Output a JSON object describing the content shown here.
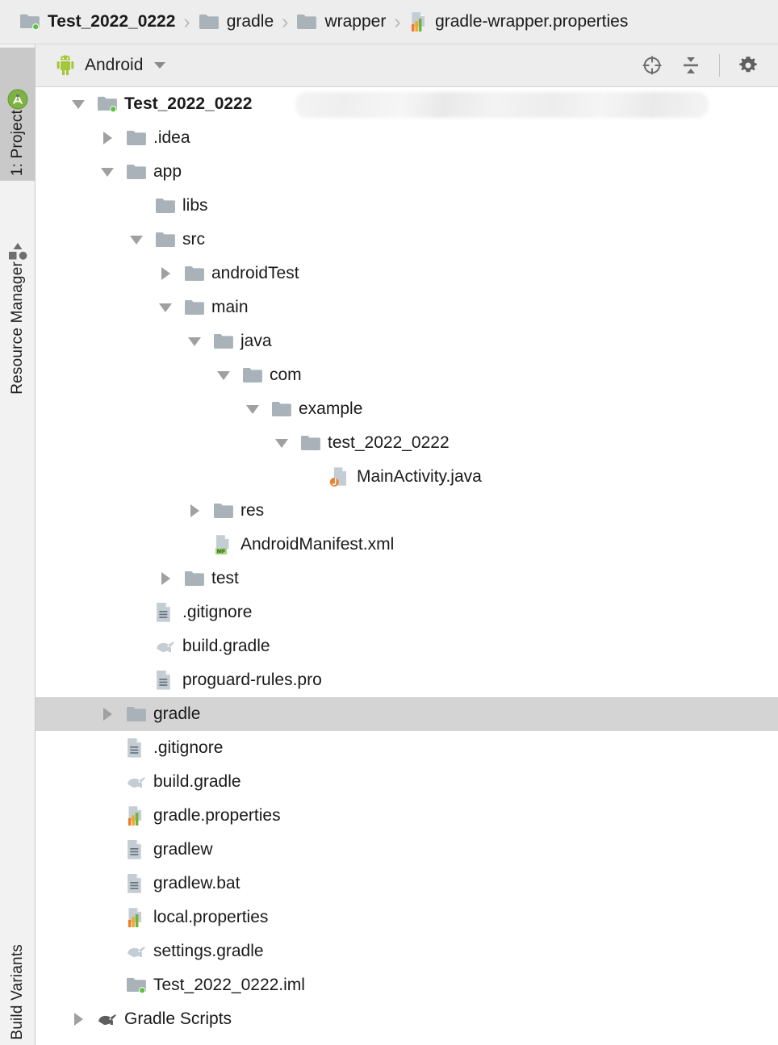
{
  "breadcrumb": {
    "items": [
      {
        "label": "Test_2022_0222",
        "icon": "module-folder-icon",
        "bold": true
      },
      {
        "label": "gradle",
        "icon": "folder-icon",
        "bold": false
      },
      {
        "label": "wrapper",
        "icon": "folder-icon",
        "bold": false
      },
      {
        "label": "gradle-wrapper.properties",
        "icon": "properties-file-icon",
        "bold": false
      }
    ],
    "separator": "›"
  },
  "left_rail": {
    "tabs": [
      {
        "label": "1: Project",
        "icon": "android-studio-icon",
        "active": true
      },
      {
        "label": "Resource Manager",
        "icon": "shapes-icon",
        "active": false
      },
      {
        "label": "Build Variants",
        "icon": "none",
        "active": false
      }
    ]
  },
  "panel_header": {
    "title": "Android",
    "icon": "android-robot-icon",
    "dropdown_icon": "chevron-down-icon",
    "actions": [
      {
        "name": "select-opened-file-button",
        "icon": "crosshair-icon"
      },
      {
        "name": "collapse-all-button",
        "icon": "collapse-all-icon"
      },
      {
        "name": "settings-button",
        "icon": "gear-icon"
      }
    ]
  },
  "tree": {
    "redacted_path": true,
    "rows": [
      {
        "label": "Test_2022_0222",
        "depth": 0,
        "arrow": "down",
        "icon": "module-folder-icon",
        "bold": true,
        "selected": false,
        "redacted": true
      },
      {
        "label": ".idea",
        "depth": 1,
        "arrow": "right",
        "icon": "folder-icon",
        "bold": false,
        "selected": false
      },
      {
        "label": "app",
        "depth": 1,
        "arrow": "down",
        "icon": "folder-icon",
        "bold": false,
        "selected": false
      },
      {
        "label": "libs",
        "depth": 2,
        "arrow": "none",
        "icon": "folder-icon",
        "bold": false,
        "selected": false
      },
      {
        "label": "src",
        "depth": 2,
        "arrow": "down",
        "icon": "folder-icon",
        "bold": false,
        "selected": false
      },
      {
        "label": "androidTest",
        "depth": 3,
        "arrow": "right",
        "icon": "folder-icon",
        "bold": false,
        "selected": false
      },
      {
        "label": "main",
        "depth": 3,
        "arrow": "down",
        "icon": "folder-icon",
        "bold": false,
        "selected": false
      },
      {
        "label": "java",
        "depth": 4,
        "arrow": "down",
        "icon": "folder-icon",
        "bold": false,
        "selected": false
      },
      {
        "label": "com",
        "depth": 5,
        "arrow": "down",
        "icon": "folder-icon",
        "bold": false,
        "selected": false
      },
      {
        "label": "example",
        "depth": 6,
        "arrow": "down",
        "icon": "folder-icon",
        "bold": false,
        "selected": false
      },
      {
        "label": "test_2022_0222",
        "depth": 7,
        "arrow": "down",
        "icon": "folder-icon",
        "bold": false,
        "selected": false
      },
      {
        "label": "MainActivity.java",
        "depth": 8,
        "arrow": "none",
        "icon": "java-file-icon",
        "bold": false,
        "selected": false
      },
      {
        "label": "res",
        "depth": 4,
        "arrow": "right",
        "icon": "folder-icon",
        "bold": false,
        "selected": false
      },
      {
        "label": "AndroidManifest.xml",
        "depth": 4,
        "arrow": "none",
        "icon": "manifest-file-icon",
        "bold": false,
        "selected": false
      },
      {
        "label": "test",
        "depth": 3,
        "arrow": "right",
        "icon": "folder-icon",
        "bold": false,
        "selected": false
      },
      {
        "label": ".gitignore",
        "depth": 2,
        "arrow": "none",
        "icon": "text-file-icon",
        "bold": false,
        "selected": false
      },
      {
        "label": "build.gradle",
        "depth": 2,
        "arrow": "none",
        "icon": "gradle-file-icon",
        "bold": false,
        "selected": false
      },
      {
        "label": "proguard-rules.pro",
        "depth": 2,
        "arrow": "none",
        "icon": "text-file-icon",
        "bold": false,
        "selected": false
      },
      {
        "label": "gradle",
        "depth": 1,
        "arrow": "right",
        "icon": "folder-icon",
        "bold": false,
        "selected": true
      },
      {
        "label": ".gitignore",
        "depth": 1,
        "arrow": "none",
        "icon": "text-file-icon",
        "bold": false,
        "selected": false
      },
      {
        "label": "build.gradle",
        "depth": 1,
        "arrow": "none",
        "icon": "gradle-file-icon",
        "bold": false,
        "selected": false
      },
      {
        "label": "gradle.properties",
        "depth": 1,
        "arrow": "none",
        "icon": "properties-file-icon",
        "bold": false,
        "selected": false
      },
      {
        "label": "gradlew",
        "depth": 1,
        "arrow": "none",
        "icon": "text-file-icon",
        "bold": false,
        "selected": false
      },
      {
        "label": "gradlew.bat",
        "depth": 1,
        "arrow": "none",
        "icon": "text-file-icon",
        "bold": false,
        "selected": false
      },
      {
        "label": "local.properties",
        "depth": 1,
        "arrow": "none",
        "icon": "properties-file-icon",
        "bold": false,
        "selected": false
      },
      {
        "label": "settings.gradle",
        "depth": 1,
        "arrow": "none",
        "icon": "gradle-file-icon",
        "bold": false,
        "selected": false
      },
      {
        "label": "Test_2022_0222.iml",
        "depth": 1,
        "arrow": "none",
        "icon": "module-folder-icon",
        "bold": false,
        "selected": false
      },
      {
        "label": "Gradle Scripts",
        "depth": 0,
        "arrow": "right",
        "icon": "gradle-dark-icon",
        "bold": false,
        "selected": false
      }
    ]
  },
  "colors": {
    "breadcrumb_bg": "#ededed",
    "panel_bg": "#ededed",
    "tree_bg": "#ffffff",
    "selection": "#d4d4d4",
    "rail_active": "#c9c9c9",
    "folder": "#a8b2b8",
    "android_green": "#a4c639",
    "java_badge": "#e8833a",
    "manifest_badge": "#a3d77c",
    "prop_orange": "#f07d28",
    "prop_yellow": "#f0a828",
    "prop_green": "#6cb33f",
    "text": "#1a1a1a"
  }
}
